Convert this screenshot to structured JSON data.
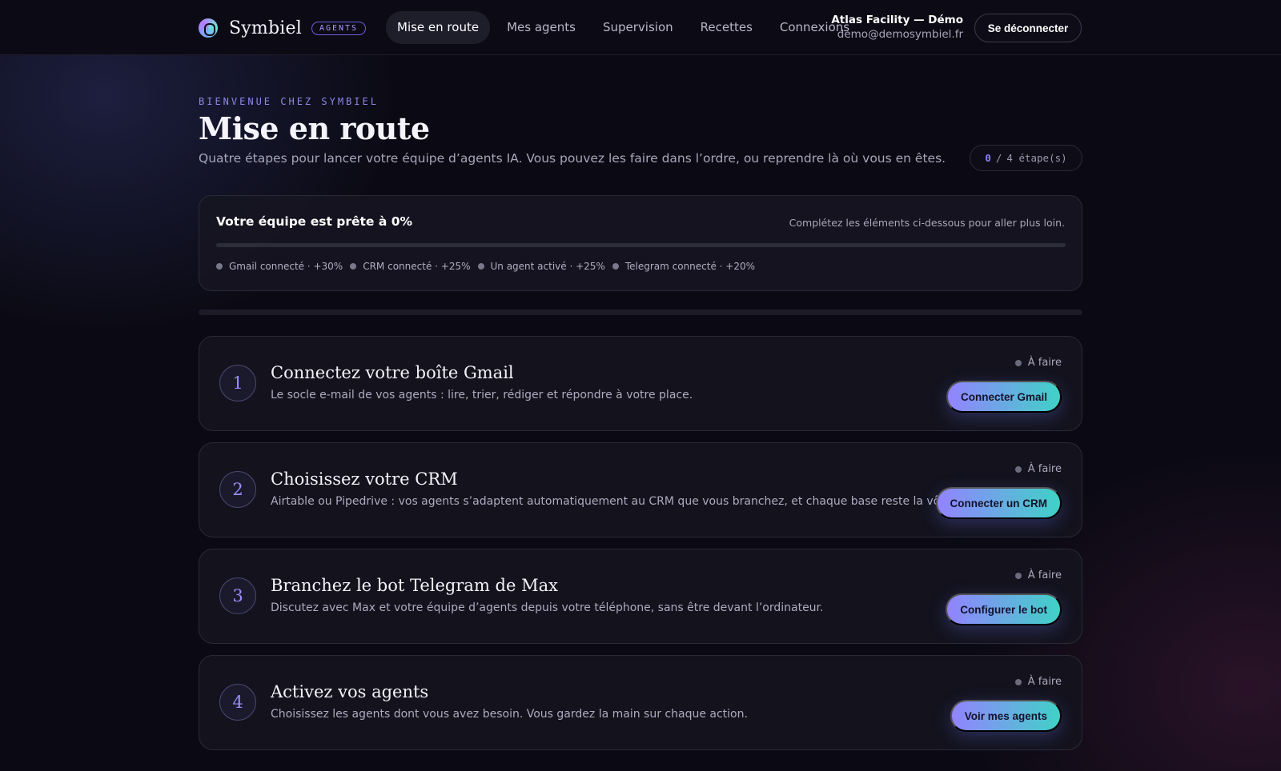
{
  "header": {
    "brand_name": "Symbiel",
    "brand_badge": "AGENTS",
    "nav": [
      {
        "label": "Mise en route",
        "active": true
      },
      {
        "label": "Mes agents",
        "active": false
      },
      {
        "label": "Supervision",
        "active": false
      },
      {
        "label": "Recettes",
        "active": false
      },
      {
        "label": "Connexions",
        "active": false
      }
    ],
    "account_name": "Atlas Facility — Démo",
    "account_email": "demo@demosymbiel.fr",
    "logout_label": "Se déconnecter"
  },
  "intro": {
    "eyebrow": "BIENVENUE CHEZ SYMBIEL",
    "title": "Mise en route",
    "subtitle": "Quatre étapes pour lancer votre équipe d’agents IA. Vous pouvez les faire dans l’ordre, ou reprendre là où vous en êtes.",
    "steps_done": "0",
    "steps_total_label": "4 étape(s)"
  },
  "readiness": {
    "title": "Votre équipe est prête à 0%",
    "hint": "Complétez les éléments ci-dessous pour aller plus loin.",
    "progress_percent": 0,
    "items": [
      {
        "label": "Gmail connecté · +30%"
      },
      {
        "label": "CRM connecté · +25%"
      },
      {
        "label": "Un agent activé · +25%"
      },
      {
        "label": "Telegram connecté · +20%"
      }
    ]
  },
  "steps": [
    {
      "number": "1",
      "title": "Connectez votre boîte Gmail",
      "description": "Le socle e-mail de vos agents : lire, trier, rédiger et répondre à votre place.",
      "status": "À faire",
      "button": "Connecter Gmail"
    },
    {
      "number": "2",
      "title": "Choisissez votre CRM",
      "description": "Airtable ou Pipedrive : vos agents s’adaptent automatiquement au CRM que vous branchez, et chaque base reste la vôtre.",
      "status": "À faire",
      "button": "Connecter un CRM"
    },
    {
      "number": "3",
      "title": "Branchez le bot Telegram de Max",
      "description": "Discutez avec Max et votre équipe d’agents depuis votre téléphone, sans être devant l’ordinateur.",
      "status": "À faire",
      "button": "Configurer le bot"
    },
    {
      "number": "4",
      "title": "Activez vos agents",
      "description": "Choisissez les agents dont vous avez besoin. Vous gardez la main sur chaque action.",
      "status": "À faire",
      "button": "Voir mes agents"
    }
  ]
}
